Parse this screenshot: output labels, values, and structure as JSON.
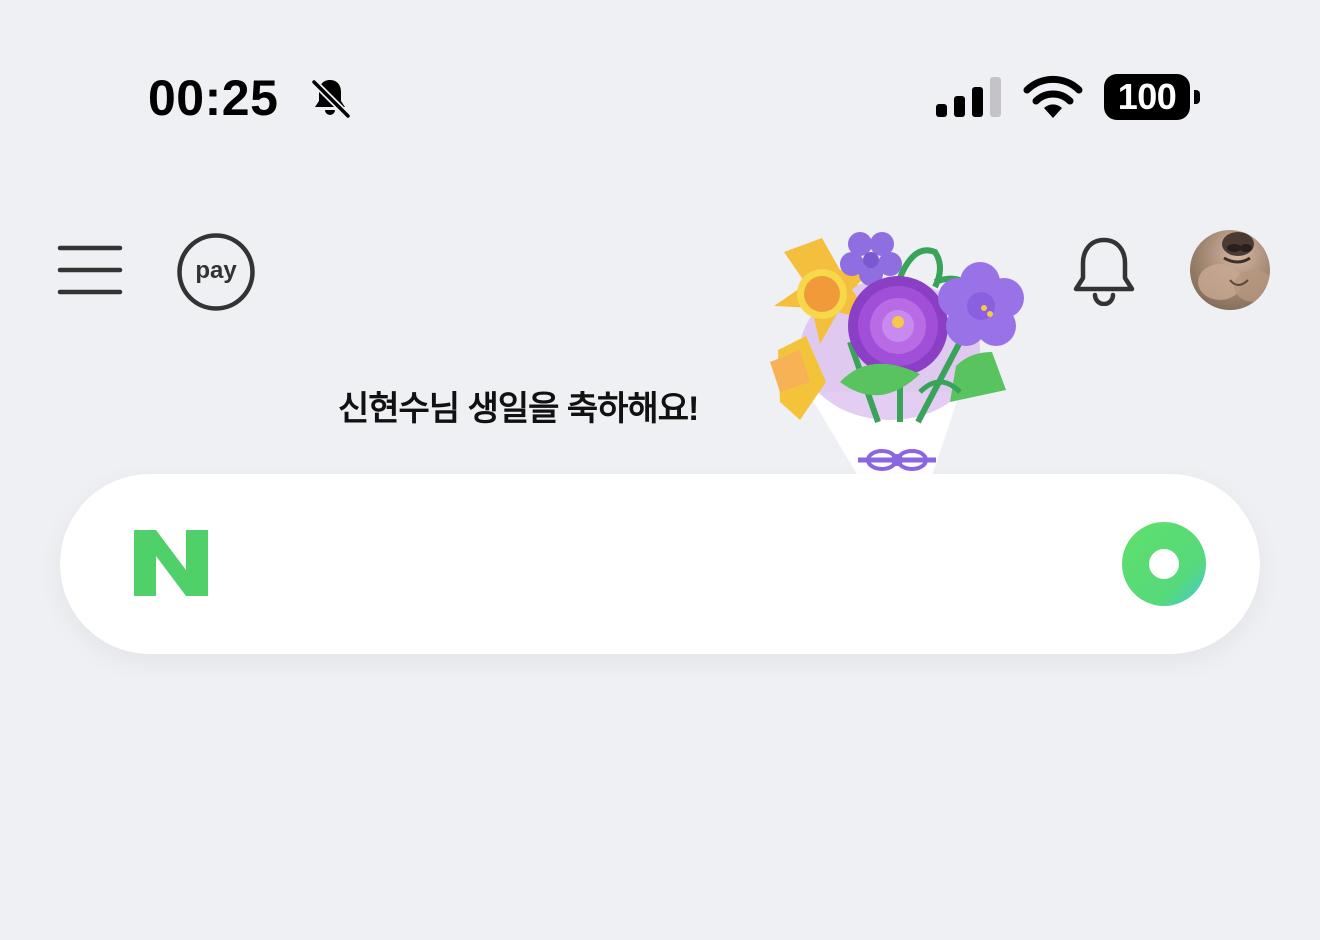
{
  "status_bar": {
    "time": "00:25",
    "silent_icon": "bell-slash-icon",
    "signal_icon": "cellular-signal-icon",
    "wifi_icon": "wifi-icon",
    "battery_level": "100"
  },
  "header": {
    "menu_icon": "hamburger-menu-icon",
    "pay_label": "pay",
    "notification_icon": "bell-icon",
    "avatar": "profile-avatar"
  },
  "birthday": {
    "message": "신현수님 생일을 축하해요!",
    "illustration": "flower-bouquet"
  },
  "search": {
    "logo": "N",
    "value": "",
    "placeholder": "",
    "action_icon": "green-dot-icon"
  },
  "colors": {
    "background": "#eff0f4",
    "naver_green": "#4fd069",
    "text": "#111111"
  }
}
